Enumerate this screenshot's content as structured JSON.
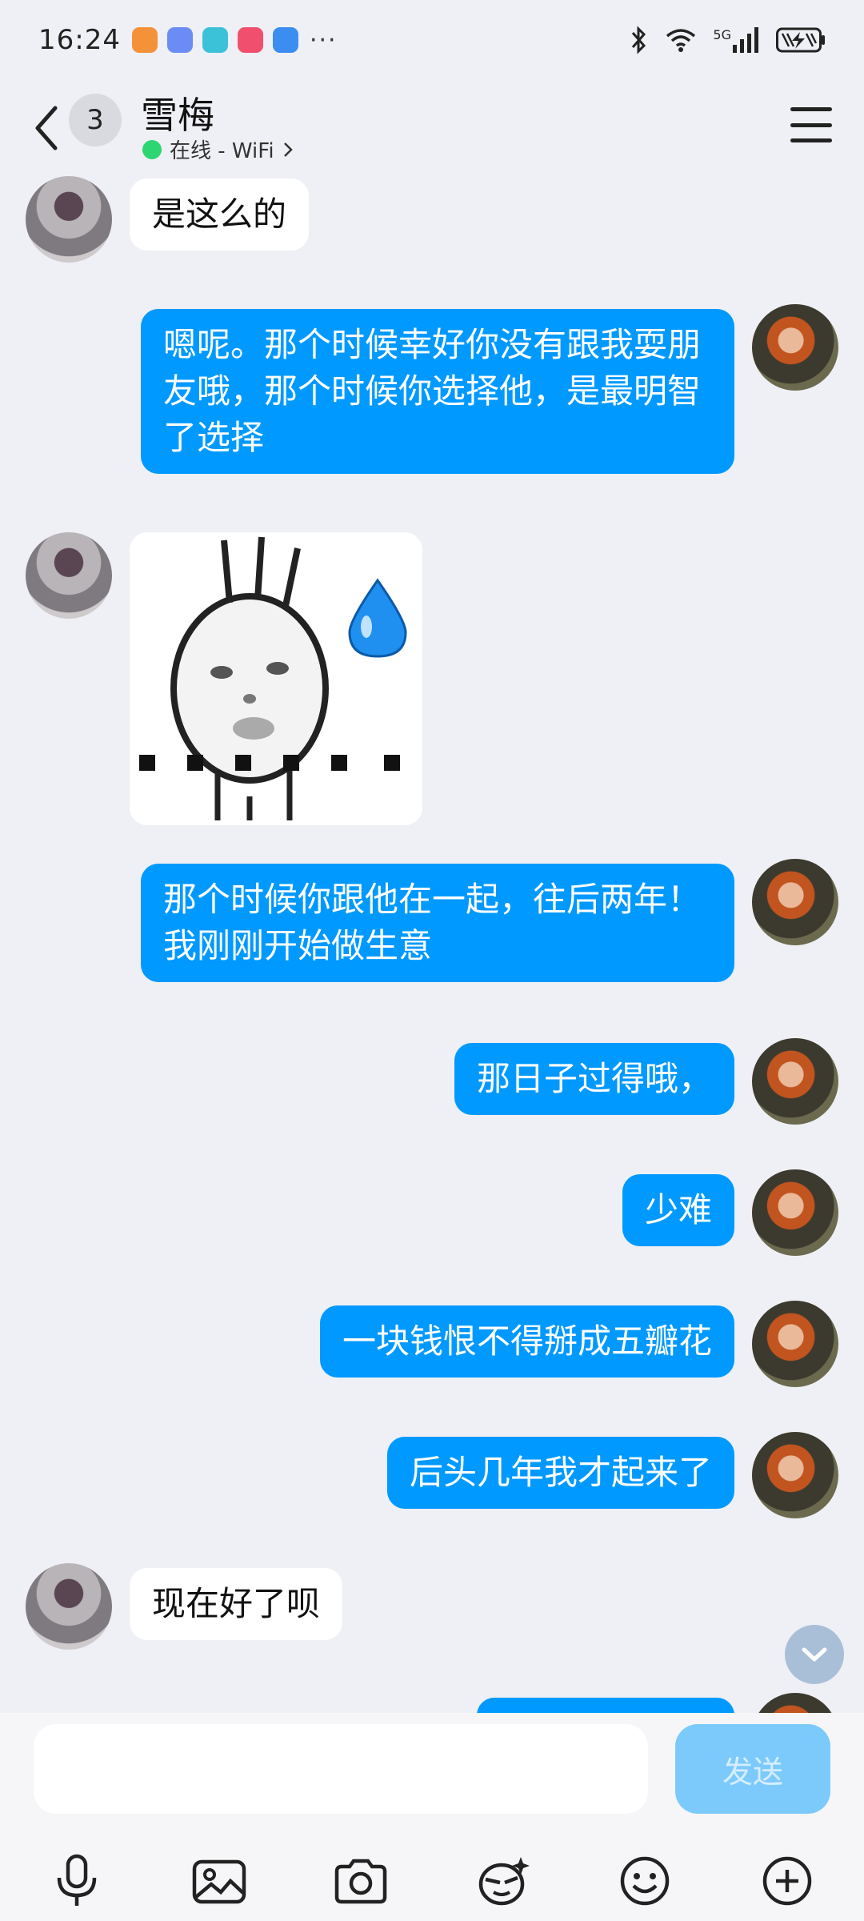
{
  "status_bar": {
    "time": "16:24",
    "more": "···",
    "network": "5G",
    "icons": [
      "bluetooth-icon",
      "wifi-icon",
      "signal-icon",
      "battery-icon"
    ]
  },
  "header": {
    "unread_count": "3",
    "contact_name": "雪梅",
    "status_text": "在线 - WiFi",
    "status_color": "#2ed573"
  },
  "messages": [
    {
      "side": "left",
      "type": "text",
      "text": "是这么的"
    },
    {
      "side": "right",
      "type": "text",
      "text": "嗯呢。那个时候幸好你没有跟我耍朋友哦，那个时候你选择他，是最明智了选择"
    },
    {
      "side": "left",
      "type": "sticker",
      "sticker": "sweat-drop-sticker"
    },
    {
      "side": "right",
      "type": "text",
      "text": "那个时候你跟他在一起，往后两年！我刚刚开始做生意"
    },
    {
      "side": "right",
      "type": "text",
      "text": "那日子过得哦，"
    },
    {
      "side": "right",
      "type": "text",
      "text": "少难"
    },
    {
      "side": "right",
      "type": "text",
      "text": "一块钱恨不得掰成五瓣花"
    },
    {
      "side": "right",
      "type": "text",
      "text": "后头几年我才起来了"
    },
    {
      "side": "left",
      "type": "text",
      "text": "现在好了呗"
    }
  ],
  "input": {
    "placeholder": "",
    "send_label": "发送"
  },
  "toolbar": {
    "items": [
      "mic-icon",
      "image-icon",
      "camera-icon",
      "magic-face-icon",
      "emoji-icon",
      "plus-icon"
    ]
  },
  "colors": {
    "accent": "#0099ff",
    "send_disabled": "#7ccafc",
    "background": "#eff0f5"
  }
}
